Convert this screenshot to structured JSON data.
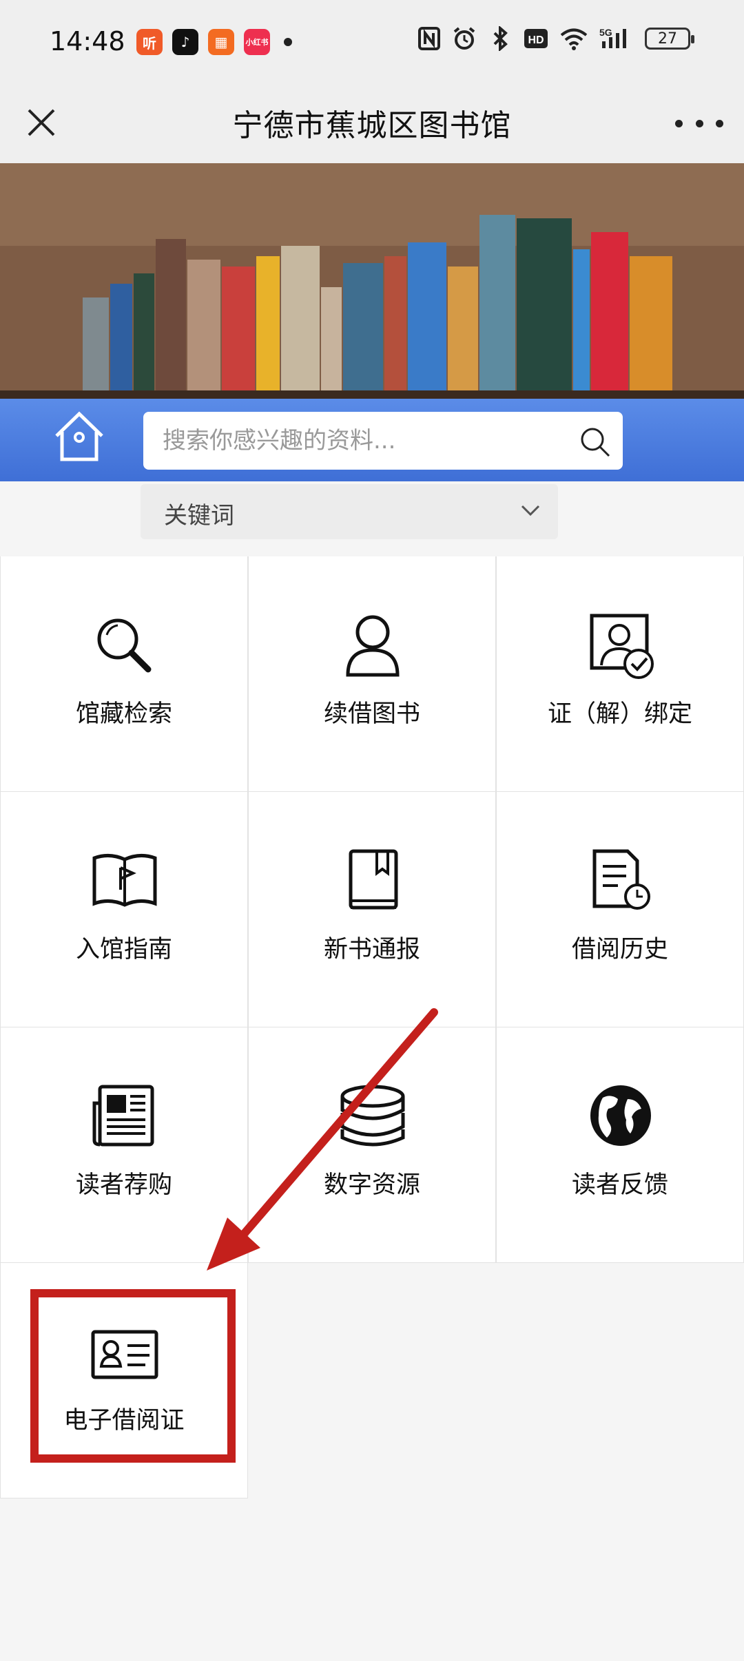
{
  "status_bar": {
    "time": "14:48",
    "battery": "27",
    "apps": [
      {
        "name": "ting-app-icon",
        "glyph": "听",
        "color": "#f05a28"
      },
      {
        "name": "douyin-app-icon",
        "glyph": "♪",
        "color": "#111111"
      },
      {
        "name": "grid-app-icon",
        "glyph": "▦",
        "color": "#f36b21"
      },
      {
        "name": "xiaohongshu-app-icon",
        "glyph": "小红书",
        "color": "#ee2f4f"
      }
    ]
  },
  "nav": {
    "title": "宁德市蕉城区图书馆"
  },
  "search": {
    "placeholder": "搜索你感兴趣的资料...",
    "filter_selected": "关键词"
  },
  "menu": {
    "items": [
      {
        "label": "馆藏检索",
        "icon": "magnifier-icon"
      },
      {
        "label": "续借图书",
        "icon": "user-icon"
      },
      {
        "label": "证（解）绑定",
        "icon": "card-bind-icon"
      },
      {
        "label": "入馆指南",
        "icon": "guide-book-icon"
      },
      {
        "label": "新书通报",
        "icon": "bookmark-book-icon"
      },
      {
        "label": "借阅历史",
        "icon": "history-document-icon"
      },
      {
        "label": "读者荐购",
        "icon": "newspaper-icon"
      },
      {
        "label": "数字资源",
        "icon": "database-icon"
      },
      {
        "label": "读者反馈",
        "icon": "globe-icon"
      },
      {
        "label": "电子借阅证",
        "icon": "id-card-icon"
      }
    ]
  },
  "colors": {
    "accent_blue": "#3f6fd6",
    "annotation_red": "#c4201c"
  }
}
